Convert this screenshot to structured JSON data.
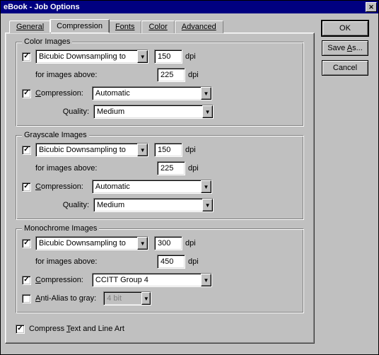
{
  "window": {
    "title": "eBook - Job Options"
  },
  "tabs": {
    "general": "General",
    "compression": "Compression",
    "fonts": "Fonts",
    "color": "Color",
    "advanced": "Advanced"
  },
  "buttons": {
    "ok": "OK",
    "save_as_pre": "Save ",
    "save_as_u": "A",
    "save_as_post": "s...",
    "cancel": "Cancel"
  },
  "groups": {
    "color": {
      "title": "Color Images",
      "method": "Bicubic Downsampling to",
      "dpi": "150",
      "dpi_unit": "dpi",
      "above_label": "for images above:",
      "above": "225",
      "comp_u": "C",
      "comp_rest": "ompression:",
      "comp_val": "Automatic",
      "qual_label": "Quality:",
      "qual_val": "Medium"
    },
    "gray": {
      "title": "Grayscale Images",
      "method": "Bicubic Downsampling to",
      "dpi": "150",
      "dpi_unit": "dpi",
      "above_label": "for images above:",
      "above": "225",
      "comp_u": "C",
      "comp_rest": "ompression:",
      "comp_val": "Automatic",
      "qual_label": "Quality:",
      "qual_val": "Medium"
    },
    "mono": {
      "title": "Monochrome Images",
      "method": "Bicubic Downsampling to",
      "dpi": "300",
      "dpi_unit": "dpi",
      "above_label": "for images above:",
      "above": "450",
      "comp_u": "C",
      "comp_rest": "ompression:",
      "comp_val": "CCITT Group 4",
      "aa_u": "A",
      "aa_rest": "nti-Alias to gray:",
      "aa_val": "4 bit"
    },
    "compress_all_pre": "Compress ",
    "compress_all_u": "T",
    "compress_all_post": "ext and Line Art"
  }
}
